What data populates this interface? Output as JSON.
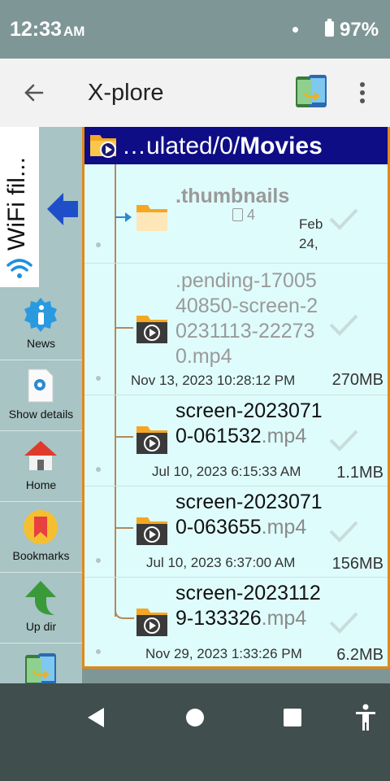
{
  "status": {
    "time": "12:33",
    "ampm": "AM",
    "battery": "97%"
  },
  "app": {
    "title": "X-plore"
  },
  "sidebar": {
    "wifi_label": "WiFi fil...",
    "items": [
      {
        "label": "News",
        "icon": "info-icon"
      },
      {
        "label": "Show details",
        "icon": "details-icon"
      },
      {
        "label": "Home",
        "icon": "home-icon"
      },
      {
        "label": "Bookmarks",
        "icon": "bookmark-icon"
      },
      {
        "label": "Up dir",
        "icon": "up-arrow-icon"
      }
    ]
  },
  "path": {
    "prefix": "…ulated/0/",
    "current": "Movies"
  },
  "files": [
    {
      "name": ".thumbnails",
      "count": "4",
      "date": "Feb 24,",
      "size": ""
    },
    {
      "name": ".pending-1700540850-screen-20231113-222730.mp4",
      "line1": ".pending-17005",
      "line2": "40850-screen-2",
      "line3": "0231113-22273",
      "line4": "0.mp4",
      "date": "Nov 13, 2023 10:28:12 PM",
      "size": "270MB"
    },
    {
      "line1": "screen-2023071",
      "line2_base": "0-061532",
      "ext": ".mp4",
      "date": "Jul 10, 2023 6:15:33 AM",
      "size": "1.1MB"
    },
    {
      "line1": "screen-2023071",
      "line2_base": "0-063655",
      "ext": ".mp4",
      "date": "Jul 10, 2023 6:37:00 AM",
      "size": "156MB"
    },
    {
      "line1": "screen-2023112",
      "line2_base": "9-133326",
      "ext": ".mp4",
      "date": "Nov 29, 2023 1:33:26 PM",
      "size": "6.2MB"
    }
  ],
  "colors": {
    "accent": "#e08a17",
    "path_bar": "#0e0d86",
    "pane": "#dffcfc"
  }
}
